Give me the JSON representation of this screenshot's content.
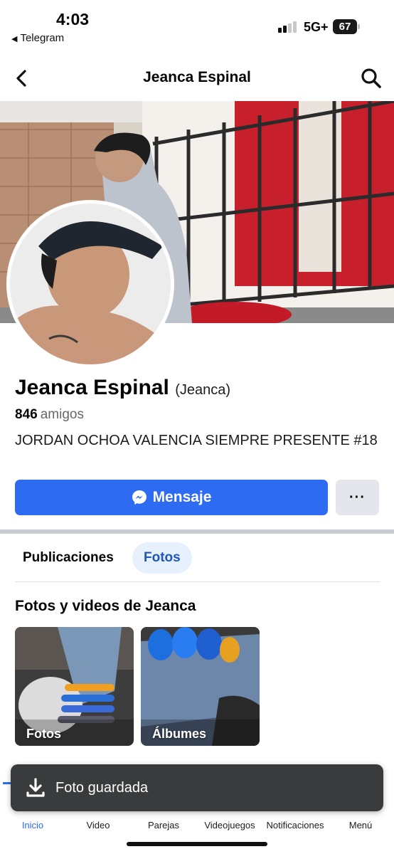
{
  "status_bar": {
    "time": "4:03",
    "back_app": "Telegram",
    "network": "5G+",
    "battery": "67"
  },
  "header": {
    "title": "Jeanca Espinal",
    "back_icon": "chevron-left-icon",
    "search_icon": "search-icon"
  },
  "profile": {
    "name": "Jeanca Espinal",
    "nickname": "(Jeanca)",
    "friends_count": "846",
    "friends_label": "amigos",
    "bio": "JORDAN OCHOA VALENCIA SIEMPRE PRESENTE #18"
  },
  "actions": {
    "message_label": "Mensaje",
    "more_label": "···"
  },
  "tabs": [
    {
      "label": "Publicaciones",
      "active": false
    },
    {
      "label": "Fotos",
      "active": true
    }
  ],
  "photos_section": {
    "title": "Fotos y videos de Jeanca",
    "tiles": [
      {
        "label": "Fotos"
      },
      {
        "label": "Álbumes"
      }
    ]
  },
  "toast": {
    "text": "Foto guardada",
    "icon": "download-icon"
  },
  "bottom_nav": [
    {
      "label": "Inicio",
      "icon": "home-icon",
      "active": true
    },
    {
      "label": "Video",
      "icon": "video-icon",
      "active": false
    },
    {
      "label": "Parejas",
      "icon": "heart-icon",
      "active": false
    },
    {
      "label": "Videojuegos",
      "icon": "gamepad-icon",
      "active": false
    },
    {
      "label": "Notificaciones",
      "icon": "bell-icon",
      "active": false
    },
    {
      "label": "Menú",
      "icon": "menu-icon",
      "active": false
    }
  ],
  "colors": {
    "accent": "#2d6cf2",
    "tab_active_bg": "#e7f0fd",
    "toast_bg": "#3a3b3c"
  }
}
